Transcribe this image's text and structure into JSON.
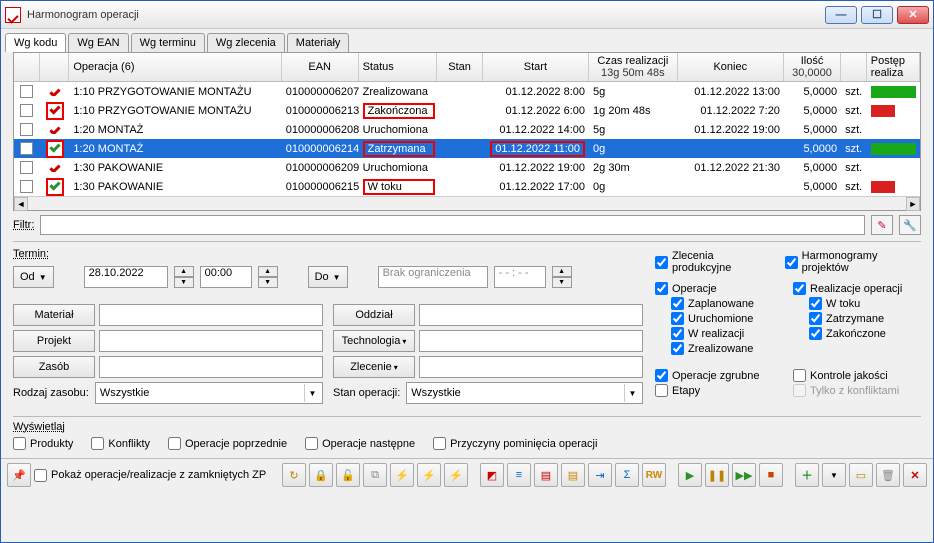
{
  "window": {
    "title": "Harmonogram operacji"
  },
  "tabs": [
    "Wg kodu",
    "Wg EAN",
    "Wg terminu",
    "Wg zlecenia",
    "Materiały"
  ],
  "active_tab": 0,
  "columns": {
    "operation": "Operacja (6)",
    "ean": "EAN",
    "status": "Status",
    "stan": "Stan",
    "start": "Start",
    "czas": "Czas realizacji",
    "czas_sub": "13g 50m 48s",
    "koniec": "Koniec",
    "ilosc": "Ilość",
    "ilosc_sub": "30,0000",
    "postep": "Postęp realiza"
  },
  "rows": [
    {
      "hl": false,
      "chk": "red-check",
      "op": "1:10 PRZYGOTOWANIE MONTAŻU",
      "ean": "010000006207",
      "status": "Zrealizowana",
      "status_hl": false,
      "stan": "",
      "start": "01.12.2022  8:00",
      "czas": "5g",
      "koniec": "01.12.2022 13:00",
      "ilosc": "5,0000",
      "unit": "szt.",
      "bar": "green"
    },
    {
      "hl": false,
      "chk": "boxed-red-check",
      "op": "1:10 PRZYGOTOWANIE MONTAŻU",
      "ean": "010000006213",
      "status": "Zakończona",
      "status_hl": true,
      "stan": "",
      "start": "01.12.2022  6:00",
      "czas": "1g 20m 48s",
      "koniec": "01.12.2022  7:20",
      "ilosc": "5,0000",
      "unit": "szt.",
      "bar": "red"
    },
    {
      "hl": false,
      "chk": "red-check",
      "op": "1:20 MONTAŻ",
      "ean": "010000006208",
      "status": "Uruchomiona",
      "status_hl": false,
      "stan": "",
      "start": "01.12.2022 14:00",
      "czas": "5g",
      "koniec": "01.12.2022 19:00",
      "ilosc": "5,0000",
      "unit": "szt.",
      "bar": ""
    },
    {
      "hl": true,
      "chk": "boxed-green-check",
      "op": "1:20 MONTAŻ",
      "ean": "010000006214",
      "status": "Zatrzymana",
      "status_hl": true,
      "stan": "",
      "start": "01.12.2022 11:00",
      "czas": "0g",
      "koniec": "",
      "ilosc": "5,0000",
      "unit": "szt.",
      "bar": "green"
    },
    {
      "hl": false,
      "chk": "red-check",
      "op": "1:30 PAKOWANIE",
      "ean": "010000006209",
      "status": "Uruchomiona",
      "status_hl": false,
      "stan": "",
      "start": "01.12.2022 19:00",
      "czas": "2g 30m",
      "koniec": "01.12.2022 21:30",
      "ilosc": "5,0000",
      "unit": "szt.",
      "bar": ""
    },
    {
      "hl": false,
      "chk": "boxed-green-check",
      "op": "1:30 PAKOWANIE",
      "ean": "010000006215",
      "status": "W toku",
      "status_hl": true,
      "stan": "",
      "start": "01.12.2022 17:00",
      "czas": "0g",
      "koniec": "",
      "ilosc": "5,0000",
      "unit": "szt.",
      "bar": "red"
    }
  ],
  "filter_label": "Filtr:",
  "termin": {
    "label": "Termin:",
    "od": "Od",
    "date": "28.10.2022",
    "time": "00:00",
    "do": "Do",
    "range": "Brak ograniczenia",
    "range_time": "- - : - -"
  },
  "form": {
    "material": "Materiał",
    "projekt": "Projekt",
    "zasob": "Zasób",
    "oddzial": "Oddział",
    "technologia": "Technologia",
    "zlecenie": "Zlecenie",
    "rodzaj_label": "Rodzaj zasobu:",
    "rodzaj_val": "Wszystkie",
    "stan_label": "Stan operacji:",
    "stan_val": "Wszystkie"
  },
  "right": {
    "zlec_prod": "Zlecenia produkcyjne",
    "harm_proj": "Harmonogramy projektów",
    "operacje": "Operacje",
    "zaplanowane": "Zaplanowane",
    "uruchomione": "Uruchomione",
    "wrealizacji": "W realizacji",
    "zrealizowane": "Zrealizowane",
    "realizacje": "Realizacje operacji",
    "wtoku": "W toku",
    "zatrzymane": "Zatrzymane",
    "zakonczone": "Zakończone",
    "zgrubne": "Operacje zgrubne",
    "etapy": "Etapy",
    "kontrole": "Kontrole jakości",
    "konflikty": "Tylko z konfliktami"
  },
  "display": {
    "label": "Wyświetlaj",
    "produkty": "Produkty",
    "konflikty": "Konflikty",
    "poprzednie": "Operacje poprzednie",
    "nastepne": "Operacje następne",
    "przyczyny": "Przyczyny pominięcia operacji"
  },
  "bottom": {
    "show_closed": "Pokaż operacje/realizacje z zamkniętych ZP"
  }
}
